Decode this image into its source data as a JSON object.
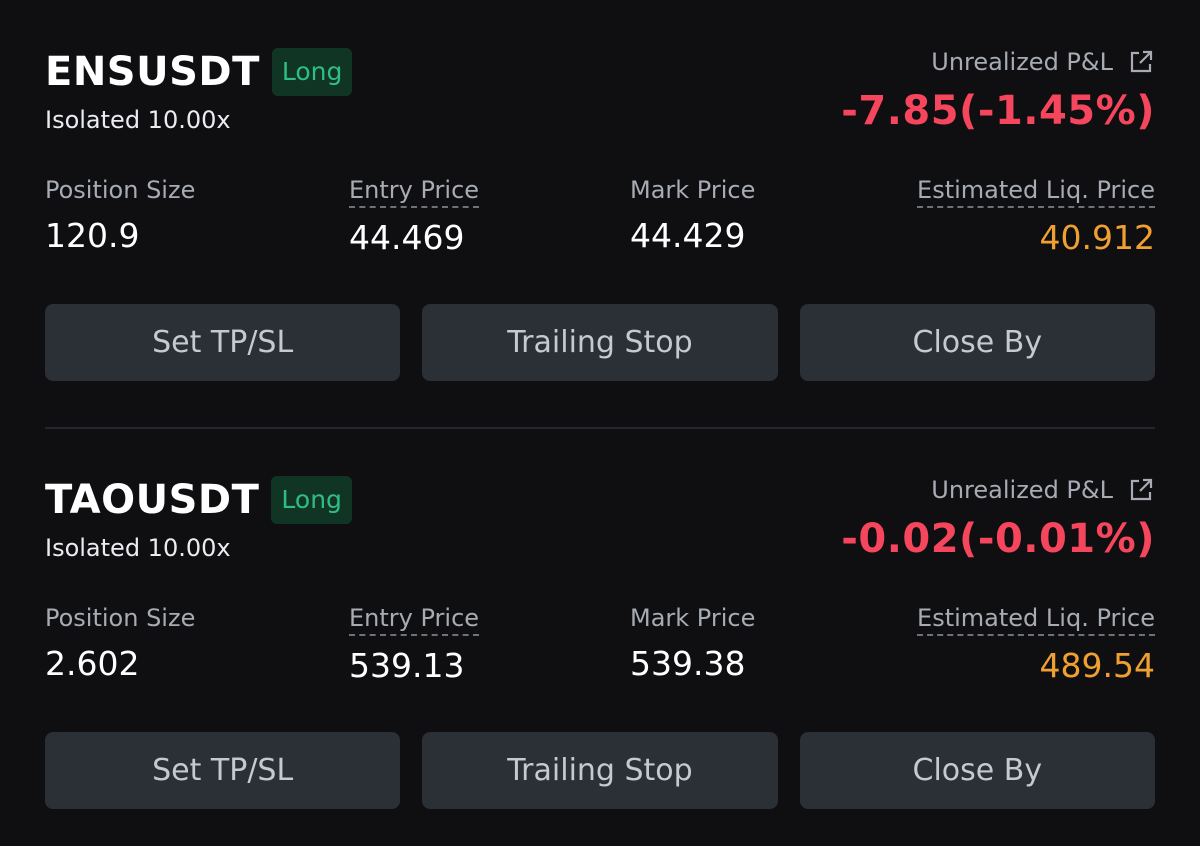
{
  "positions": [
    {
      "symbol": "ENSUSDT",
      "side": "Long",
      "margin_mode": "Isolated 10.00x",
      "pnl_label": "Unrealized P&L",
      "pnl_value": "-7.85(-1.45%)",
      "position_size_label": "Position Size",
      "position_size": "120.9",
      "entry_price_label": "Entry Price",
      "entry_price": "44.469",
      "mark_price_label": "Mark Price",
      "mark_price": "44.429",
      "liq_price_label": "Estimated Liq. Price",
      "liq_price": "40.912",
      "buttons": {
        "tpsl": "Set TP/SL",
        "trailing": "Trailing Stop",
        "close_by": "Close By"
      }
    },
    {
      "symbol": "TAOUSDT",
      "side": "Long",
      "margin_mode": "Isolated 10.00x",
      "pnl_label": "Unrealized P&L",
      "pnl_value": "-0.02(-0.01%)",
      "position_size_label": "Position Size",
      "position_size": "2.602",
      "entry_price_label": "Entry Price",
      "entry_price": "539.13",
      "mark_price_label": "Mark Price",
      "mark_price": "539.38",
      "liq_price_label": "Estimated Liq. Price",
      "liq_price": "489.54",
      "buttons": {
        "tpsl": "Set TP/SL",
        "trailing": "Trailing Stop",
        "close_by": "Close By"
      }
    }
  ],
  "colors": {
    "background": "#0f0f12",
    "long_green": "#2ebd85",
    "loss_red": "#f6465d",
    "liq_orange": "#f0a030",
    "button_bg": "#2b2f36"
  },
  "icons": {
    "share": "external-link-icon"
  }
}
